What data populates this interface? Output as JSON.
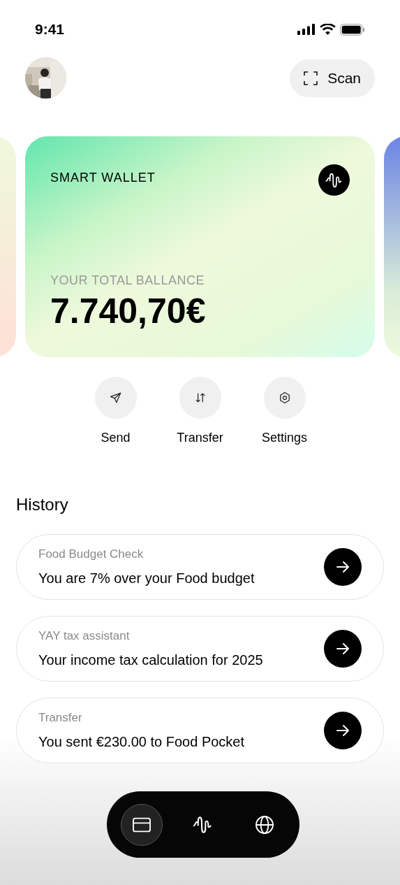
{
  "status_bar": {
    "time": "9:41"
  },
  "header": {
    "scan_button": "Scan"
  },
  "card": {
    "title": "SMART WALLET",
    "balance_label": "YOUR TOTAL BALLANCE",
    "balance": "7.740,70€"
  },
  "actions": [
    {
      "kind": "send",
      "label": "Send"
    },
    {
      "kind": "transfer",
      "label": "Transfer"
    },
    {
      "kind": "settings",
      "label": "Settings"
    }
  ],
  "history": {
    "title": "History",
    "items": [
      {
        "title": "Food Budget Check",
        "text": "You are 7% over your Food budget"
      },
      {
        "title": "YAY tax assistant",
        "text": "Your income tax calculation for 2025"
      },
      {
        "title": "Transfer",
        "text": "You sent €230.00 to Food Pocket"
      }
    ]
  },
  "nav": [
    {
      "kind": "card",
      "selected": true
    },
    {
      "kind": "wave",
      "selected": false
    },
    {
      "kind": "globe",
      "selected": false
    }
  ]
}
